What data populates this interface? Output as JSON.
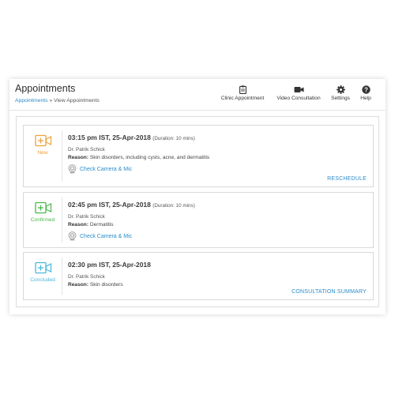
{
  "header": {
    "title": "Appointments",
    "breadcrumb": {
      "link": "Appointments",
      "separator": " » ",
      "current": "View Appointments"
    },
    "actions": [
      {
        "label": "Clinic Appointment",
        "icon": "clipboard-icon"
      },
      {
        "label": "Video Consultation",
        "icon": "video-camera-icon"
      },
      {
        "label": "Settings",
        "icon": "gear-icon"
      },
      {
        "label": "Help",
        "icon": "help-icon"
      }
    ]
  },
  "appointments": [
    {
      "status": "New",
      "status_color": "#f0a13c",
      "time": "03:15 pm IST, 25-Apr-2018",
      "duration": "(Duration: 10 mins)",
      "doctor": "Dr. Patrik Schick",
      "reason_label": "Reason:",
      "reason": "Skin disorders, including cysts, acne, and dermatitis",
      "camera_check": "Check Camera & Mic",
      "action": "RESCHEDULE"
    },
    {
      "status": "Confirmed",
      "status_color": "#4cb64c",
      "time": "02:45 pm IST, 25-Apr-2018",
      "duration": "(Duration: 10 mins)",
      "doctor": "Dr. Patrik Schick",
      "reason_label": "Reason:",
      "reason": "Dermatitis",
      "camera_check": "Check Camera & Mic"
    },
    {
      "status": "Concluded",
      "status_color": "#49b7dc",
      "time": "02:30 pm IST, 25-Apr-2018",
      "doctor": "Dr. Patrik Schick",
      "reason_label": "Reason:",
      "reason": "Skin disorders",
      "action": "CONSULTATION SUMMARY"
    }
  ],
  "colors": {
    "link": "#2a8cc9",
    "text": "#3a3a3a"
  }
}
